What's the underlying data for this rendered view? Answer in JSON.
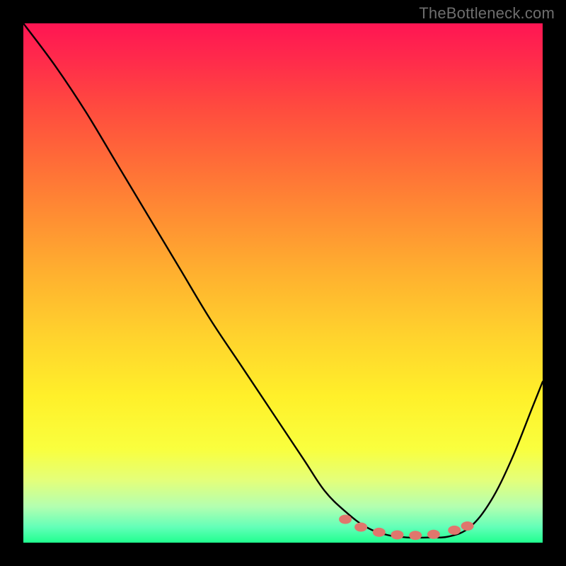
{
  "watermark": "TheBottleneck.com",
  "chart_data": {
    "type": "line",
    "title": "",
    "xlabel": "",
    "ylabel": "",
    "xlim": [
      0,
      100
    ],
    "ylim": [
      0,
      100
    ],
    "grid": false,
    "legend": false,
    "series": [
      {
        "name": "curve",
        "color": "#000000",
        "x": [
          0,
          6,
          12,
          18,
          24,
          30,
          36,
          42,
          48,
          54,
          58,
          62,
          66,
          70,
          74,
          78,
          82,
          86,
          90,
          94,
          98,
          100
        ],
        "values": [
          100,
          92,
          83,
          73,
          63,
          53,
          43,
          34,
          25,
          16,
          10,
          6,
          3,
          1.5,
          1.0,
          1.0,
          1.2,
          3,
          8,
          16,
          26,
          31
        ]
      }
    ],
    "markers": {
      "color": "#e0766d",
      "points": [
        {
          "x": 62,
          "y": 4.5
        },
        {
          "x": 65,
          "y": 3.0
        },
        {
          "x": 68.5,
          "y": 2.0
        },
        {
          "x": 72,
          "y": 1.5
        },
        {
          "x": 75.5,
          "y": 1.4
        },
        {
          "x": 79,
          "y": 1.6
        },
        {
          "x": 83,
          "y": 2.4
        },
        {
          "x": 85.5,
          "y": 3.2
        }
      ]
    }
  }
}
